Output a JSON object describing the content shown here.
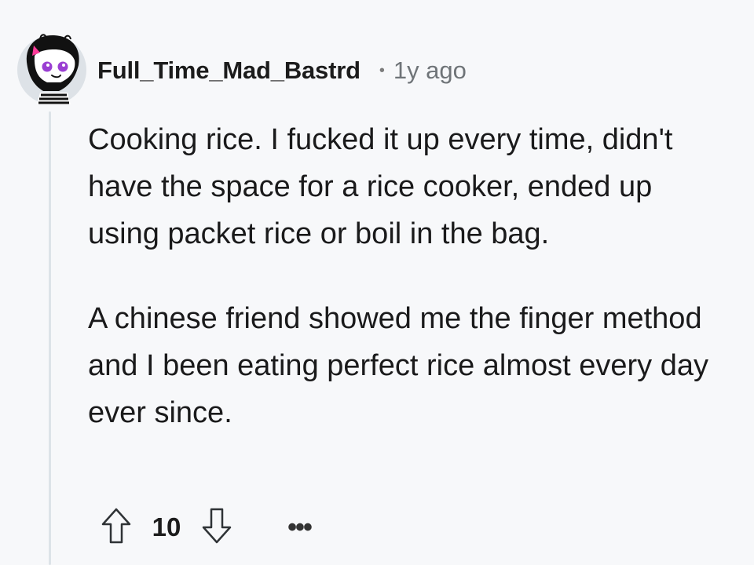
{
  "comment": {
    "author": "Full_Time_Mad_Bastrd",
    "separator": "•",
    "timestamp": "1y ago",
    "body": [
      "Cooking rice. I fucked it up every time, didn't have the space for a rice cooker, ended up using packet rice or boil in the bag.",
      "A chinese friend showed me the finger method and I been eating perfect rice almost every day ever since."
    ],
    "score": "10",
    "more": "•••"
  },
  "icons": {
    "avatar": "user-avatar-icon",
    "upvote": "upvote-arrow-icon",
    "downvote": "downvote-arrow-icon",
    "more": "more-options-icon"
  },
  "colors": {
    "background": "#f7f8fa",
    "text": "#1a1a1b",
    "muted": "#6f7478",
    "thread_line": "#dde3e8"
  }
}
